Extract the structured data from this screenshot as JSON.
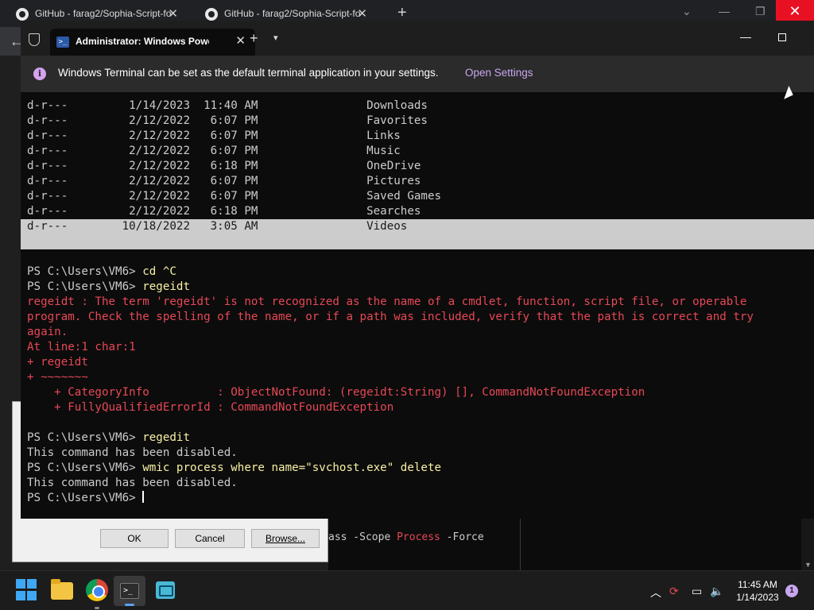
{
  "browser": {
    "tabs": [
      {
        "title": "GitHub - farag2/Sophia-Script-fo"
      },
      {
        "title": "GitHub - farag2/Sophia-Script-fo"
      }
    ],
    "new_tab": "+",
    "close_glyph": "✕"
  },
  "bg_dialog": {
    "ok_label": "OK",
    "cancel_label": "Cancel",
    "browse_label": "Browse..."
  },
  "bg_terminal": {
    "pre": "ass -Scope ",
    "process": "Process",
    "post": " -Force"
  },
  "terminal": {
    "tab_title": "Administrator: Windows PowerShell",
    "tab_icon": "powershell-icon",
    "new_tab": "+",
    "dropdown": "⌄",
    "minimize": "—",
    "info_text": "Windows Terminal can be set as the default terminal application in your settings.",
    "info_link": "Open Settings",
    "listing": [
      {
        "mode": "d-r---",
        "date": "1/14/2023",
        "time": "11:40 AM",
        "name": "Downloads"
      },
      {
        "mode": "d-r---",
        "date": "2/12/2022",
        "time": "6:07 PM",
        "name": "Favorites"
      },
      {
        "mode": "d-r---",
        "date": "2/12/2022",
        "time": "6:07 PM",
        "name": "Links"
      },
      {
        "mode": "d-r---",
        "date": "2/12/2022",
        "time": "6:07 PM",
        "name": "Music"
      },
      {
        "mode": "d-r---",
        "date": "2/12/2022",
        "time": "6:18 PM",
        "name": "OneDrive"
      },
      {
        "mode": "d-r---",
        "date": "2/12/2022",
        "time": "6:07 PM",
        "name": "Pictures"
      },
      {
        "mode": "d-r---",
        "date": "2/12/2022",
        "time": "6:07 PM",
        "name": "Saved Games"
      },
      {
        "mode": "d-r---",
        "date": "2/12/2022",
        "time": "6:18 PM",
        "name": "Searches"
      },
      {
        "mode": "d-r---",
        "date": "10/18/2022",
        "time": "3:05 AM",
        "name": "Videos"
      }
    ],
    "prompt": "PS C:\\Users\\VM6> ",
    "cmd1": "cd ^C",
    "cmd2": "regeidt",
    "err1": "regeidt : The term 'regeidt' is not recognized as the name of a cmdlet, function, script file, or operable",
    "err2": "program. Check the spelling of the name, or if a path was included, verify that the path is correct and try",
    "err3": "again.",
    "err4": "At line:1 char:1",
    "err5": "+ regeidt",
    "err6": "+ ~~~~~~~",
    "err7": "    + CategoryInfo          : ObjectNotFound: (regeidt:String) [], CommandNotFoundException",
    "err8": "    + FullyQualifiedErrorId : CommandNotFoundException",
    "cmd3": "regedit",
    "out1": "This command has been disabled.",
    "cmd4": "wmic process where name=\"svchost.exe\" delete",
    "out2": "This command has been disabled."
  },
  "taskbar": {
    "time": "11:45 AM",
    "date": "1/14/2023",
    "notifications": "1",
    "tray_chevron": "︿"
  }
}
